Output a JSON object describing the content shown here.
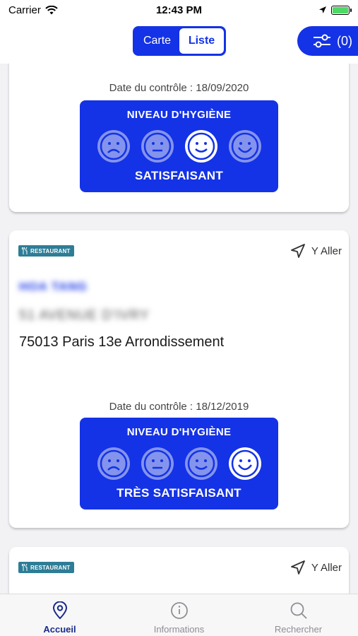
{
  "status_bar": {
    "carrier": "Carrier",
    "time": "12:43 PM"
  },
  "top_nav": {
    "segments": [
      {
        "label": "Carte",
        "active": false
      },
      {
        "label": "Liste",
        "active": true
      }
    ],
    "filter_count": "(0)"
  },
  "colors": {
    "primary": "#1432e6",
    "tag": "#2e7d96",
    "tab_active": "#1a2a8a"
  },
  "cards": [
    {
      "control_date": "Date du contrôle : 18/09/2020",
      "hygiene_title": "NIVEAU D'HYGIÈNE",
      "hygiene_level": "SATISFAISANT",
      "selected_face_index": 2
    },
    {
      "tag": "RESTAURANT",
      "go_label": "Y Aller",
      "name": "HOA TANG",
      "street": "51 AVENUE D'IVRY",
      "city": "75013 Paris 13e  Arrondissement",
      "control_date": "Date du contrôle : 18/12/2019",
      "hygiene_title": "NIVEAU D'HYGIÈNE",
      "hygiene_level": "TRÈS SATISFAISANT",
      "selected_face_index": 3
    },
    {
      "tag": "RESTAURANT",
      "go_label": "Y Aller"
    }
  ],
  "tab_bar": {
    "tabs": [
      {
        "label": "Accueil",
        "icon": "location-pin-icon",
        "active": true
      },
      {
        "label": "Informations",
        "icon": "info-icon",
        "active": false
      },
      {
        "label": "Rechercher",
        "icon": "search-icon",
        "active": false
      }
    ]
  }
}
